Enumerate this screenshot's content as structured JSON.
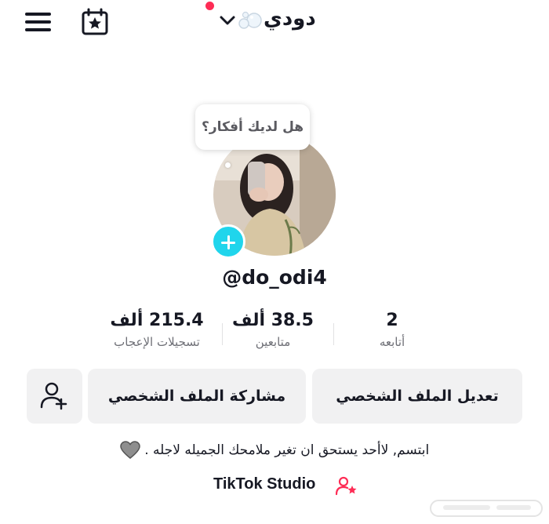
{
  "header": {
    "title": "دودي",
    "menu_icon": "hamburger-menu-icon",
    "calendar_icon": "calendar-star-icon",
    "chevron_icon": "chevron-down-icon",
    "notification_color": "#fe2c55"
  },
  "profile": {
    "thought_bubble": "هل لديك أفكار؟",
    "username": "@do_odi4",
    "add_photo_color": "#20d5ec"
  },
  "stats": [
    {
      "value": "2",
      "label": "أتابعه"
    },
    {
      "value": "38.5 ألف",
      "label": "متابعين"
    },
    {
      "value": "215.4 ألف",
      "label": "تسجيلات الإعجاب"
    }
  ],
  "actions": {
    "edit_profile": "تعديل الملف الشخصي",
    "share_profile": "مشاركة الملف الشخصي",
    "add_friend_icon": "add-friend-icon"
  },
  "bio": {
    "text": "ابتسم, لاأحد يستحق ان تغير ملامحك الجميله لاجله ."
  },
  "studio": {
    "label": "TikTok Studio",
    "icon_color": "#fe2c55"
  }
}
